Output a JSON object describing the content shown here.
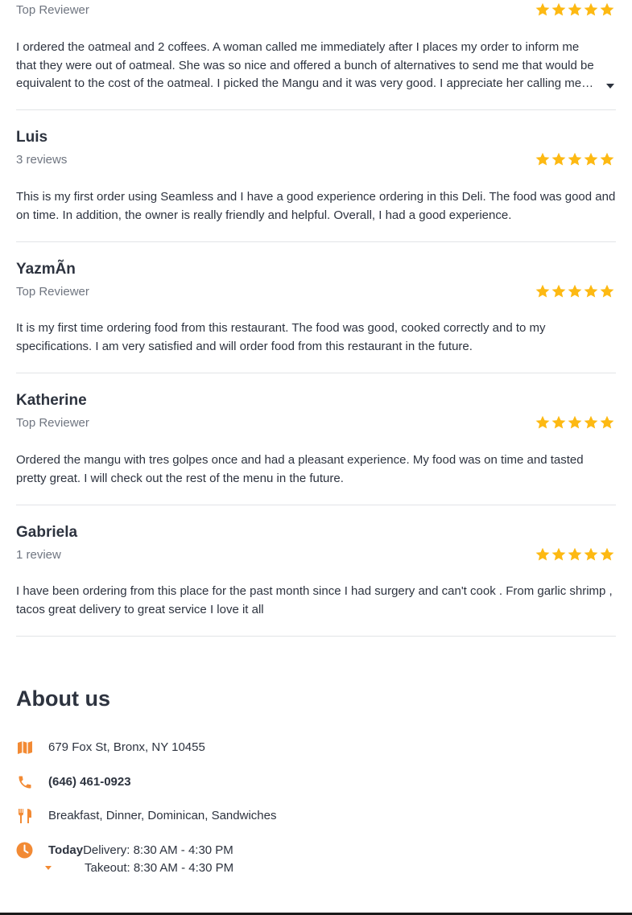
{
  "colors": {
    "star": "#fdb913",
    "accent": "#f28a34",
    "text": "#2d333f",
    "muted": "#6f7580",
    "divider": "#e2e4e7"
  },
  "reviews": [
    {
      "name": "",
      "subtitle": "Top Reviewer",
      "rating": 5,
      "text": "I ordered the oatmeal and 2 coffees. A woman called me immediately after I places my order to inform me that they were out of oatmeal. She was so nice and offered a bunch of alternatives to send me that would be equivalent to the cost of the oatmeal. I picked the Mangu and it was very good. I appreciate her calling me…",
      "truncated": true
    },
    {
      "name": "Luis",
      "subtitle": "3 reviews",
      "rating": 5,
      "text": "This is my first order using Seamless and I have a good experience ordering in this Deli. The food was good and on time. In addition, the owner is really friendly and helpful. Overall, I had a good experience."
    },
    {
      "name": "YazmÃn",
      "subtitle": "Top Reviewer",
      "rating": 5,
      "text": "It is my first time ordering food from this restaurant. The food was good, cooked correctly and to my specifications. I am very satisfied and will order food from this restaurant in the future."
    },
    {
      "name": "Katherine",
      "subtitle": "Top Reviewer",
      "rating": 5,
      "text": "Ordered the mangu with tres golpes once and had a pleasant experience. My food was on time and tasted pretty great. I will check out the rest of the menu in the future."
    },
    {
      "name": "Gabriela",
      "subtitle": "1 review",
      "rating": 5,
      "text": "I have been ordering from this place for the past month since I had surgery and can't cook . From garlic shrimp , tacos great delivery to great service I love it all"
    }
  ],
  "about": {
    "title": "About us",
    "address": "679 Fox St, Bronx, NY 10455",
    "phone": "(646) 461-0923",
    "cuisines": "Breakfast, Dinner, Dominican, Sandwiches",
    "hours": {
      "today_label": "Today",
      "delivery": "Delivery: 8:30 AM - 4:30 PM",
      "takeout": "Takeout: 8:30 AM - 4:30 PM"
    },
    "icons": {
      "address": "map-icon",
      "phone": "phone-icon",
      "cuisines": "utensils-icon",
      "hours": "clock-icon"
    }
  }
}
